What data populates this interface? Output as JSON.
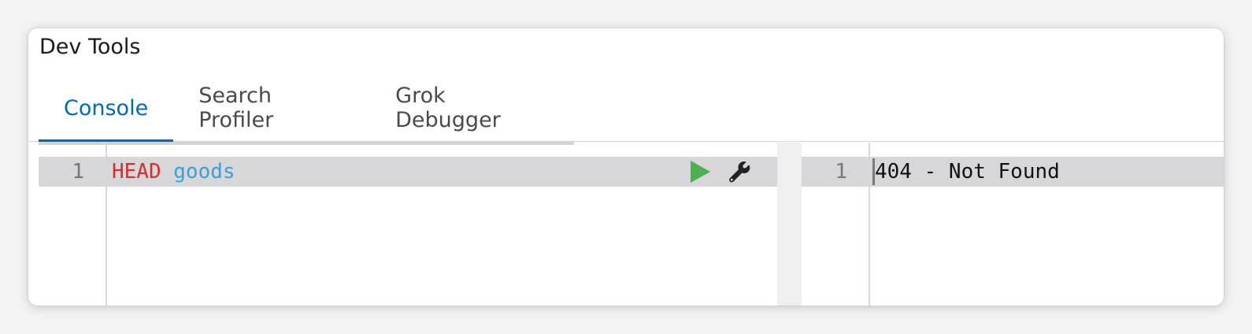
{
  "window": {
    "title": "Dev Tools"
  },
  "tabs": [
    {
      "label": "Console",
      "active": true
    },
    {
      "label": "Search Profiler",
      "active": false
    },
    {
      "label": "Grok Debugger",
      "active": false
    }
  ],
  "request_editor": {
    "line_number": "1",
    "method": "HEAD",
    "path": "goods",
    "run_icon": "play-icon",
    "settings_icon": "wrench-icon"
  },
  "response_editor": {
    "line_number": "1",
    "text": "404 - Not Found"
  },
  "colors": {
    "accent": "#006bb4",
    "method": "#d3302b",
    "path": "#3ba1d4",
    "run": "#4caf50"
  }
}
